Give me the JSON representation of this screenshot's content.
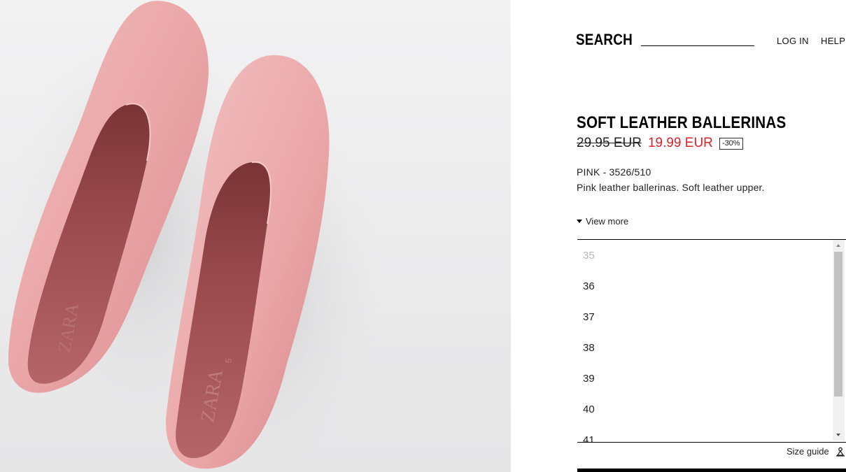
{
  "header": {
    "search_label": "SEARCH",
    "login_label": "LOG IN",
    "help_label": "HELP"
  },
  "product": {
    "title": "SOFT LEATHER BALLERINAS",
    "old_price": "29.95 EUR",
    "new_price": "19.99 EUR",
    "discount": "-30%",
    "color_ref": "PINK - 3526/510",
    "description": "Pink leather ballerinas. Soft leather upper.",
    "view_more_label": "View more",
    "insole_brand": "ZARA"
  },
  "sizes": [
    {
      "label": "35",
      "available": false
    },
    {
      "label": "36",
      "available": true
    },
    {
      "label": "37",
      "available": true
    },
    {
      "label": "38",
      "available": true
    },
    {
      "label": "39",
      "available": true
    },
    {
      "label": "40",
      "available": true
    },
    {
      "label": "41",
      "available": true
    }
  ],
  "size_guide_label": "Size guide",
  "colors": {
    "accent_price": "#e0202a",
    "shoe_pink": "#e9a7a9",
    "insole": "#9e4c4f"
  }
}
